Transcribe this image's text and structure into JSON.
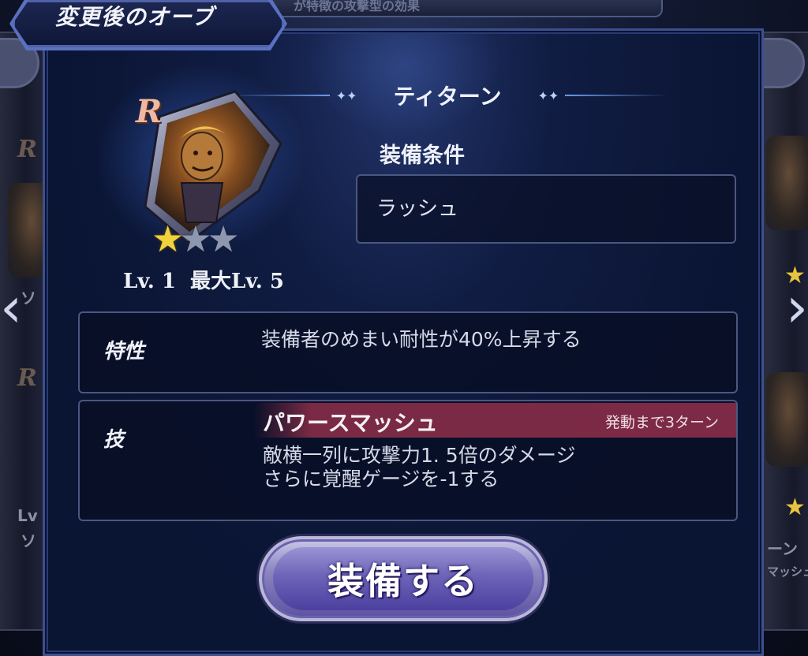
{
  "background": {
    "top_text": "が特徴の攻撃型の効果",
    "left_card": {
      "rarity": "R",
      "rarity_2": "R",
      "text_1": "ソ",
      "text_2": "Lv",
      "text_3": "ソ"
    },
    "right_card": {
      "text_1": "ーン",
      "text_2": "マッシュ"
    }
  },
  "dialog": {
    "header_title": "変更後のオーブ",
    "orb": {
      "name": "ティターン",
      "rarity": "R",
      "stars_filled": 1,
      "stars_total": 3,
      "level": "Lv. 1",
      "max_level": "最大Lv. 5"
    },
    "requirement": {
      "label": "装備条件",
      "value": "ラッシュ"
    },
    "trait": {
      "label": "特性",
      "description": "装備者のめまい耐性が40%上昇する"
    },
    "skill": {
      "label": "技",
      "name": "パワースマッシュ",
      "cooldown": "発動まで3ターン",
      "description_line1": "敵横一列に攻撃力1. 5倍のダメージ",
      "description_line2": "さらに覚醒ゲージを-1する"
    },
    "equip_button_label": "装備する"
  },
  "colors": {
    "panel_border": "#4a5880",
    "skill_header": "#7a2a44",
    "star_filled": "#f2d23c",
    "star_empty": "#8d97b0",
    "button": "#6e64b8"
  },
  "icons": {
    "nav_left": "chevron-left-icon",
    "nav_right": "chevron-right-icon",
    "star": "star-icon",
    "sparkle": "sparkle-icon"
  }
}
